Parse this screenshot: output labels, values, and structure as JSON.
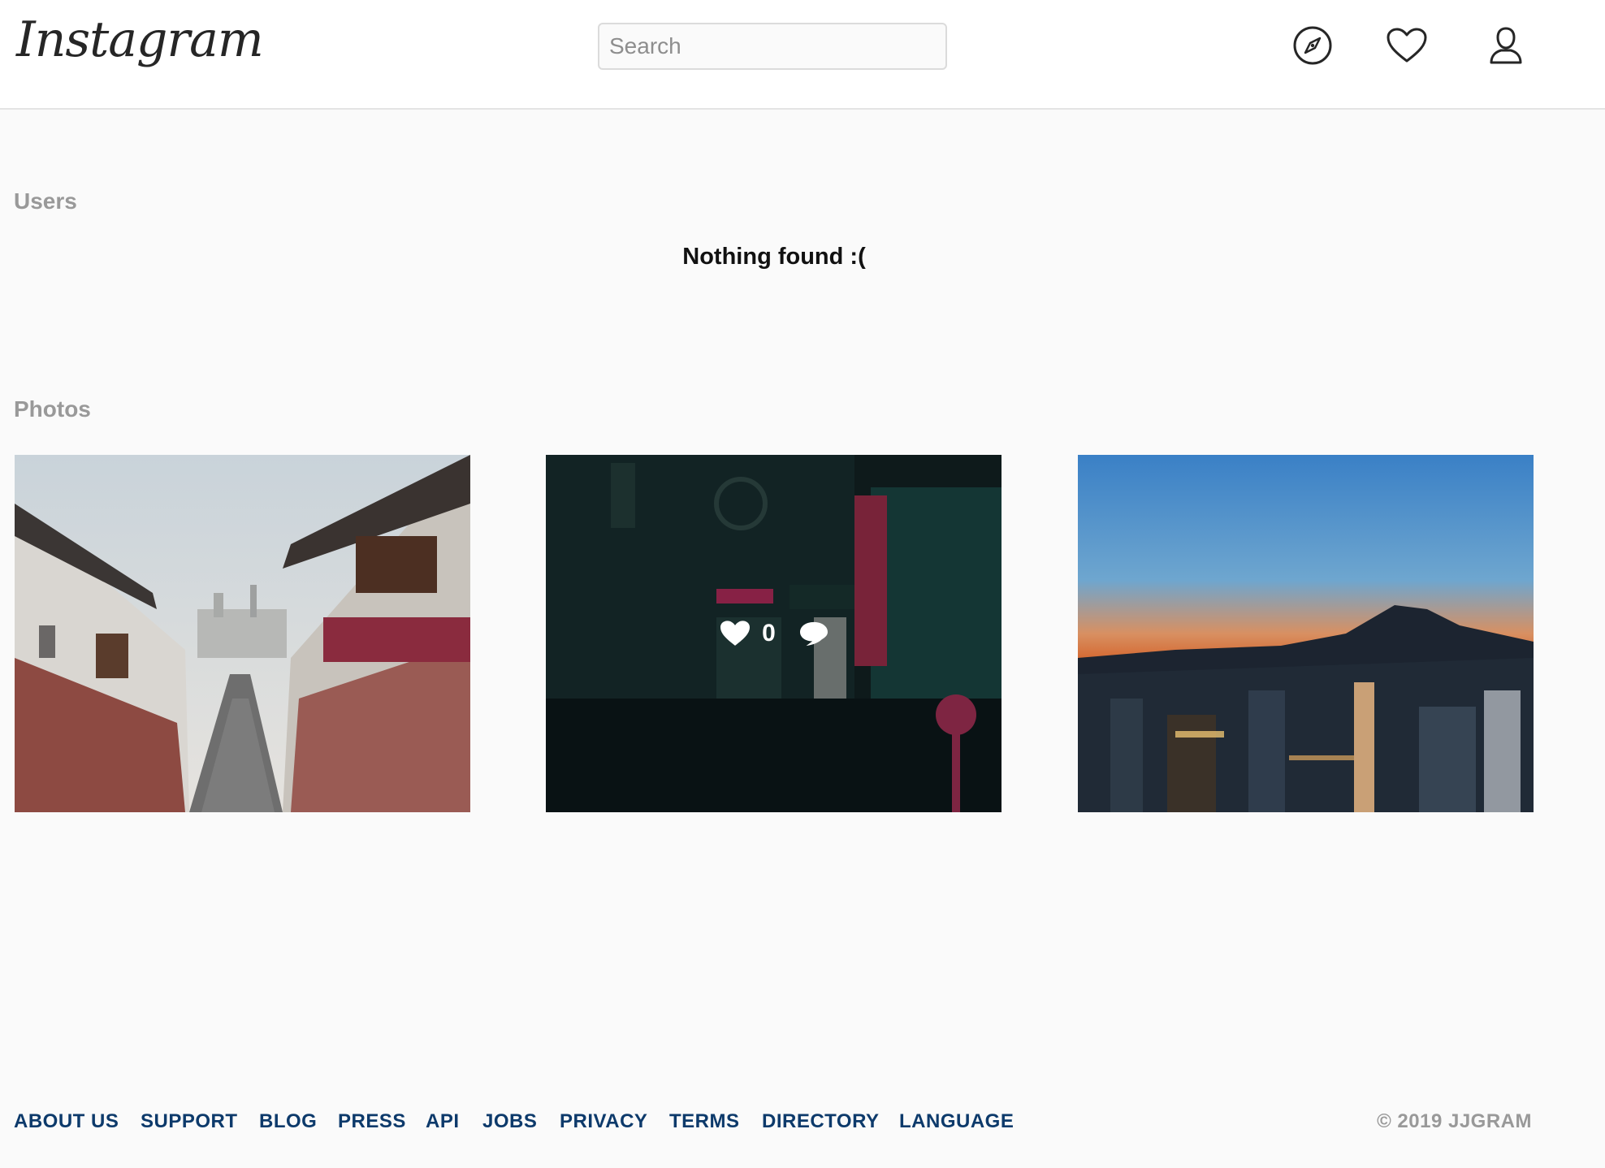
{
  "header": {
    "logo_text": "Instagram",
    "search_placeholder": "Search",
    "icons": [
      "compass-icon",
      "heart-icon",
      "profile-icon"
    ]
  },
  "users": {
    "label": "Users",
    "empty_message": "Nothing found :("
  },
  "photos": {
    "label": "Photos",
    "items": [
      {
        "subject": "hanok-alley"
      },
      {
        "subject": "neon-street",
        "likes": "0",
        "hover": true
      },
      {
        "subject": "city-dusk"
      }
    ]
  },
  "footer": {
    "links": [
      "ABOUT US",
      "SUPPORT",
      "BLOG",
      "PRESS",
      "API",
      "JOBS",
      "PRIVACY",
      "TERMS",
      "DIRECTORY",
      "LANGUAGE"
    ],
    "copyright": "© 2019 JJGRAM"
  }
}
